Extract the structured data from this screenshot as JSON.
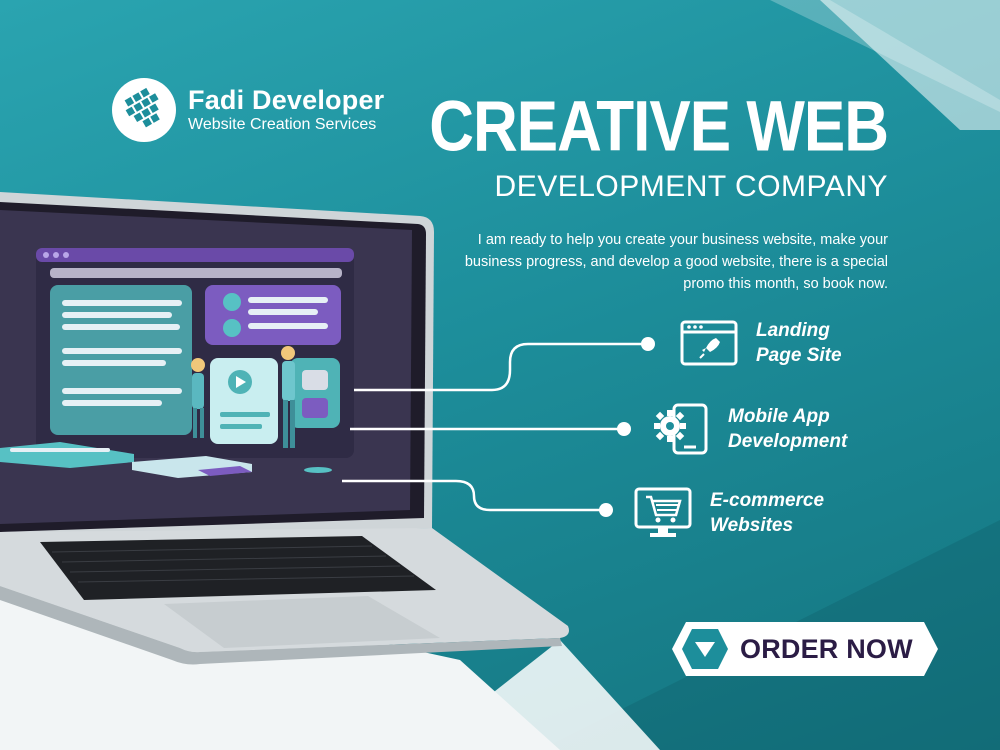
{
  "brand": {
    "name": "Fadi Developer",
    "tagline": "Website Creation Services",
    "logo_icon": "grid-cube-logo-icon"
  },
  "headline": {
    "title": "CREATIVE WEB",
    "subtitle": "DEVELOPMENT COMPANY",
    "description": "I am ready to help you create your business website, make your business progress, and develop a good website, there is a special promo this month, so book now."
  },
  "services": [
    {
      "line1": "Landing",
      "line2": "Page Site",
      "icon": "rocket-browser-icon"
    },
    {
      "line1": "Mobile App",
      "line2": "Development",
      "icon": "gear-phone-icon"
    },
    {
      "line1": "E-commerce",
      "line2": "Websites",
      "icon": "shopping-cart-monitor-icon"
    }
  ],
  "cta": {
    "label": "ORDER NOW",
    "icon": "chevron-down-icon"
  },
  "colors": {
    "background": "#1d8e9b",
    "accent_purple": "#6a4aa8",
    "cta_text": "#2b1c45",
    "white": "#ffffff"
  }
}
